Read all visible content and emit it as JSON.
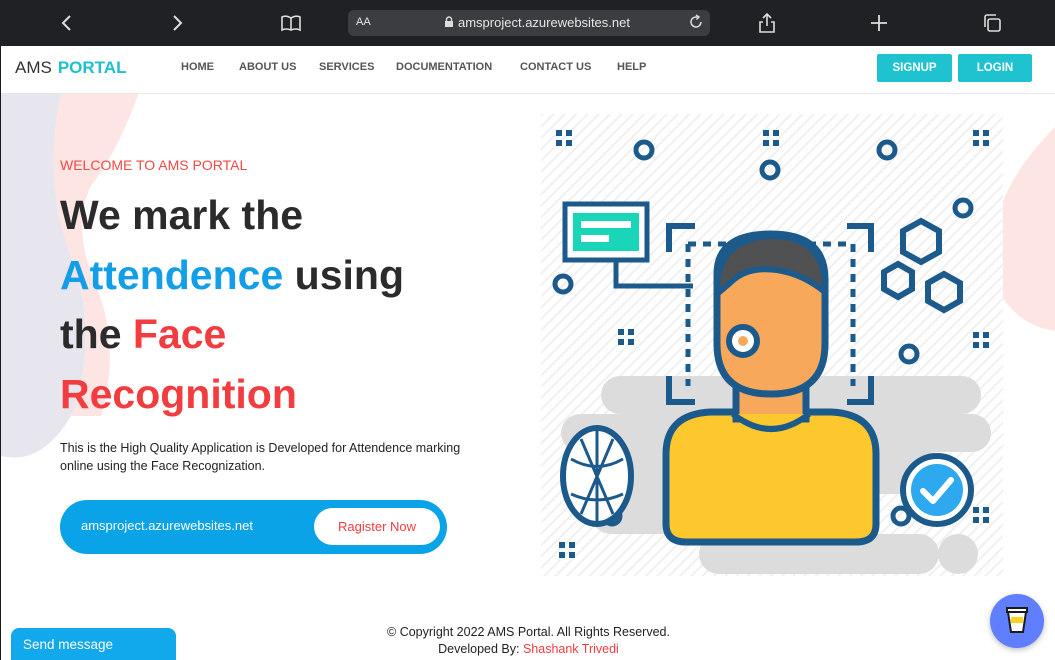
{
  "browser": {
    "text_size_label": "AA",
    "url": "amsproject.azurewebsites.net"
  },
  "navbar": {
    "logo_part1": "AMS",
    "logo_part2": "PORTAL",
    "links": [
      "HOME",
      "ABOUT US",
      "SERVICES",
      "DOCUMENTATION",
      "CONTACT US",
      "HELP"
    ],
    "signup_label": "SIGNUP",
    "login_label": "LOGIN"
  },
  "hero": {
    "welcome": "WELCOME TO AMS PORTAL",
    "headline_1": "We mark the",
    "headline_2a": "Attendence",
    "headline_2b": "using",
    "headline_3a": "the",
    "headline_3b": "Face",
    "headline_4": "Recognition",
    "description": "This is the High Quality Application is Developed for Attendence marking online using the Face Recognization.",
    "cta_label": "amsproject.azurewebsites.net",
    "register_label": "Ragister Now"
  },
  "footer": {
    "copyright": "© Copyright 2022 AMS Portal. All Rights Reserved.",
    "developed_by": "Developed By:",
    "author": "Shashank Trivedi"
  },
  "widgets": {
    "send_message": "Send message"
  },
  "colors": {
    "accent_teal": "#1ec3cf",
    "accent_blue": "#149ee8",
    "accent_red": "#f23d40",
    "illustration_navy": "#1d5a8c"
  },
  "icons": [
    "back-icon",
    "forward-icon",
    "bookmarks-icon",
    "lock-icon",
    "reload-icon",
    "share-icon",
    "new-tab-icon",
    "tabs-icon",
    "coffee-cup-icon"
  ]
}
